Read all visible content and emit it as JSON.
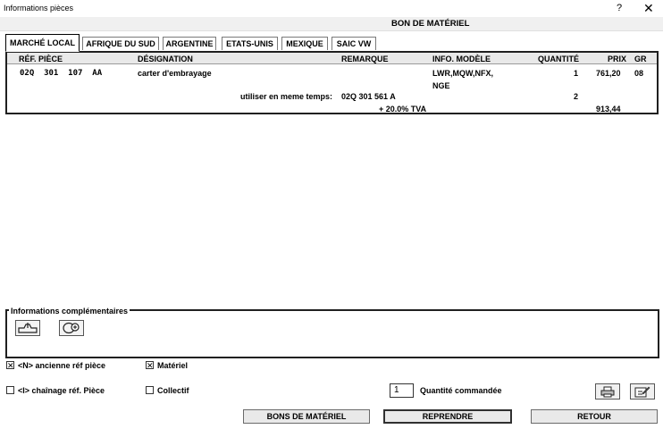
{
  "window": {
    "title": "Informations pièces",
    "help": "?",
    "close": "✕"
  },
  "header": {
    "title": "BON DE MATÉRIEL"
  },
  "tabs": [
    "MARCHÉ LOCAL",
    "AFRIQUE DU SUD",
    "ARGENTINE",
    "ETATS-UNIS",
    "MEXIQUE",
    "SAIC VW"
  ],
  "active_tab": "MARCHÉ LOCAL",
  "table": {
    "columns": [
      "RÉF. PIÈCE",
      "DÉSIGNATION",
      "REMARQUE",
      "INFO. MODÈLE",
      "QUANTITÉ",
      "PRIX",
      "GR"
    ],
    "row": {
      "ref": "02Q  301  107  AA",
      "designation": "carter d'embrayage",
      "info_line1": "LWR,MQW,NFX,",
      "info_line2": "NGE",
      "quantity": "1",
      "price": "761,20",
      "gr": "08"
    },
    "also_label": "utiliser en meme temps:",
    "also_ref": "02Q 301 561 A",
    "also_qty": "2",
    "tva_label": "+ 20.0% TVA",
    "tva_price": "913,44"
  },
  "info": {
    "label": "Informations complémentaires",
    "icons": [
      "part-view-icon",
      "zoom-in-icon"
    ]
  },
  "options": {
    "ancienne": {
      "label": "<N> ancienne réf pièce",
      "checked": true
    },
    "materiel": {
      "label": "Matériel",
      "checked": true
    },
    "chainage": {
      "label": "<I> chaînage réf. Pièce",
      "checked": false
    },
    "collectif": {
      "label": "Collectif",
      "checked": false
    }
  },
  "quantity": {
    "value": "1",
    "label": "Quantité commandée"
  },
  "buttons": {
    "bons": "BONS DE MATÉRIEL",
    "reprendre": "REPRENDRE",
    "retour": "RETOUR"
  }
}
